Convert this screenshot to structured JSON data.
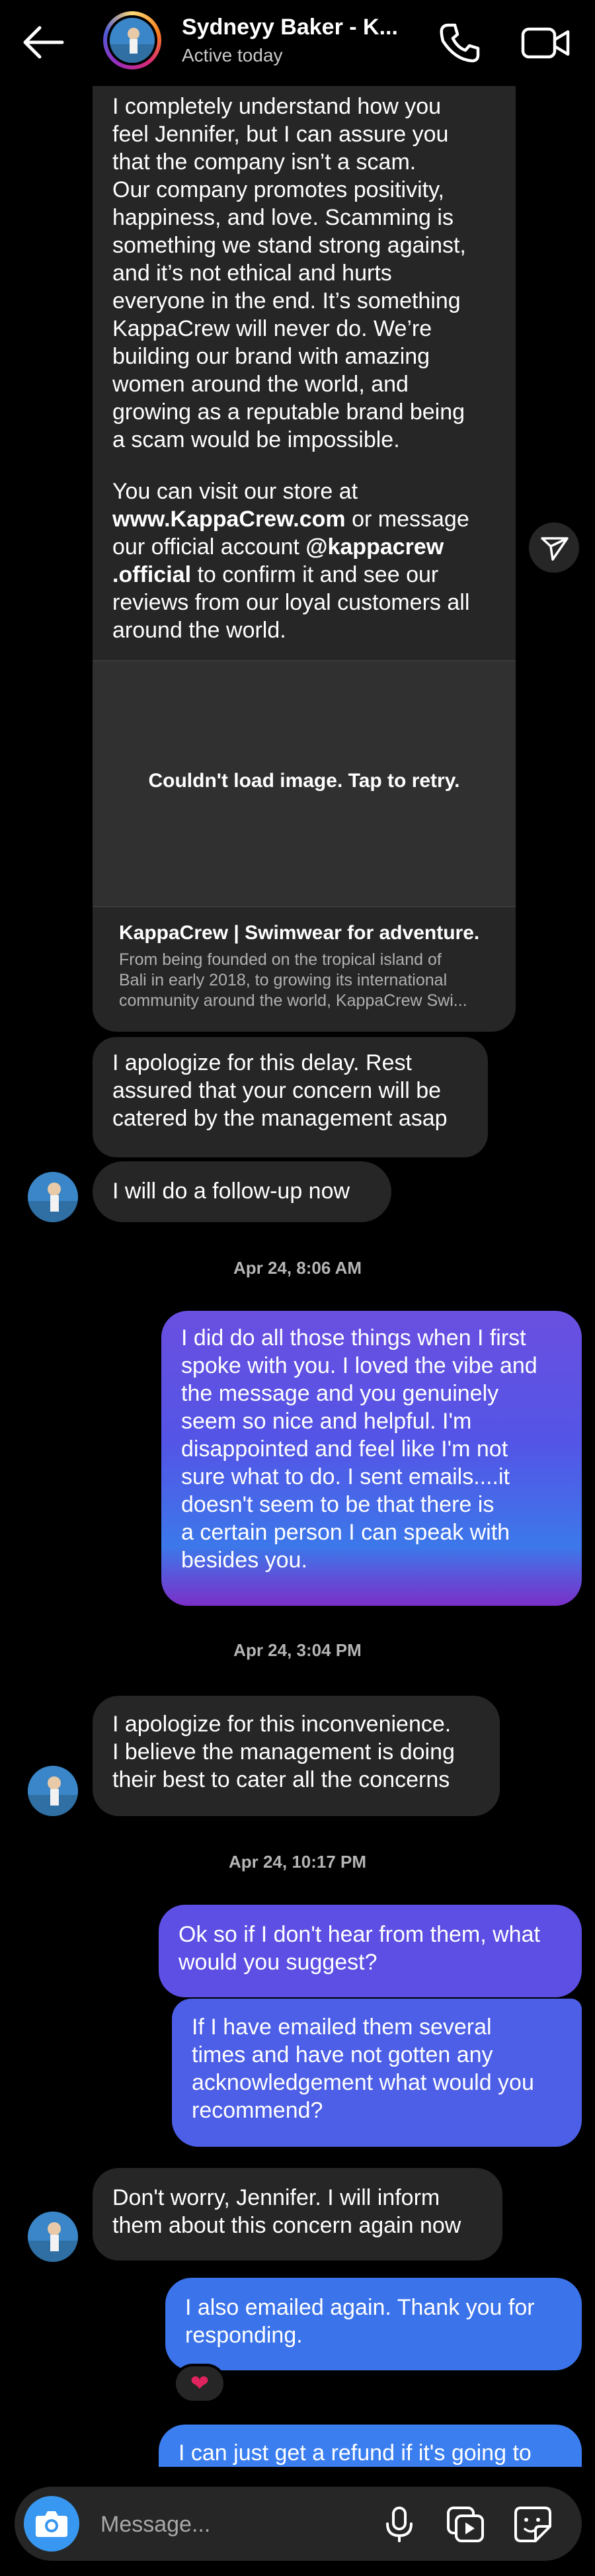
{
  "header": {
    "back_icon": "arrow-left-icon",
    "name": "Sydneyy Baker - K...",
    "status": "Active today",
    "call_icon": "phone-icon",
    "video_icon": "video-camera-icon"
  },
  "messages": {
    "m1": "I completely understand how you\nfeel Jennifer, but I can assure you\nthat the company isn’t a scam.\nOur company promotes positivity,\nhappiness, and love. Scamming is\nsomething we stand strong against,\nand it’s not ethical and hurts\neveryone in the end. It’s something\nKappaCrew will never do. We’re\nbuilding our brand with amazing\nwomen around the world, and\ngrowing as a reputable brand being\na scam would be impossible.",
    "m1_visit_prefix": "You can visit our store at",
    "m1_site": "www.KappaCrew.com",
    "m1_mid": " or message\nour official account ",
    "m1_handle_a": "@kappacrew",
    "m1_handle_b": ".official",
    "m1_tail": " to confirm it and see our\nreviews from our loyal customers all\naround the world.",
    "image_error": "Couldn't load image. Tap to retry.",
    "link_title": "KappaCrew | Swimwear for adventure.",
    "link_desc": "From being founded on the tropical island of\nBali in early 2018, to growing its international\ncommunity around the world, KappaCrew Swi...",
    "m2": "I apologize for this delay. Rest\nassured that your concern will be\ncatered by the management asap",
    "m3": "I will do a follow-up now",
    "ts1": "Apr 24, 8:06 AM",
    "m4": "I did do all those things when I first\nspoke with you. I loved the vibe and\nthe message and you genuinely\nseem so nice and helpful. I'm\ndisappointed and feel like I'm not\nsure what to do. I sent emails....it\ndoesn't seem to be that there is\na certain person I can speak with\nbesides you.",
    "ts2": "Apr 24, 3:04 PM",
    "m5": "I apologize for this inconvenience.\nI believe the management is doing\ntheir best to cater all the concerns",
    "ts3": "Apr 24, 10:17 PM",
    "m6": "Ok so if I don't hear from them, what\nwould you suggest?",
    "m7": "If I have emailed them several\ntimes and have not gotten any\nacknowledgement what would you\nrecommend?",
    "m8": "Don't worry, Jennifer. I will inform\nthem about this concern again now",
    "m9": "I also emailed again. Thank you for\nresponding.",
    "reaction": "❤",
    "m10": "I can just get a refund if it's going to\nbe an issue. I'd rather not. I would"
  },
  "composer": {
    "placeholder": "Message...",
    "camera_icon": "camera-icon",
    "mic_icon": "microphone-icon",
    "gallery_icon": "gallery-icon",
    "sticker_icon": "sticker-icon"
  },
  "colors": {
    "background": "#000000",
    "received_bubble": "#262626",
    "sent_bubble": "#3b6fe9",
    "camera_button": "#3897f0"
  }
}
